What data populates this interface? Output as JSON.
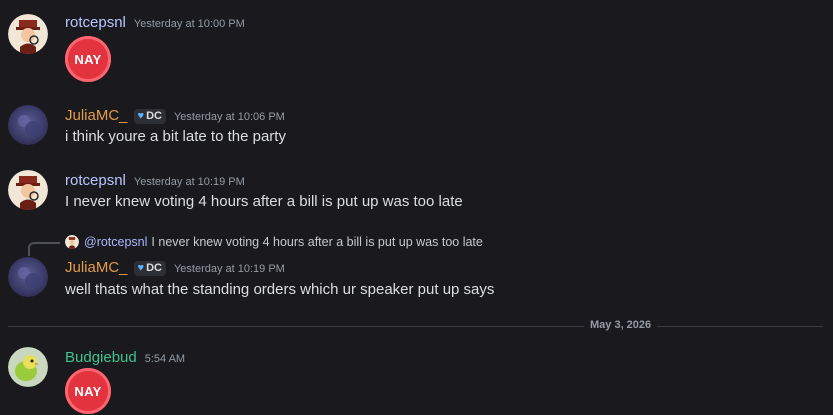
{
  "colors": {
    "background": "#1a1a1e",
    "rotcepsnl": "#b7c7ff",
    "juliamc": "#e59a4b",
    "budgiebud": "#3fc28e",
    "nay_red": "#e2333f"
  },
  "messages": [
    {
      "username": "rotcepsnl",
      "timestamp": "Yesterday at 10:00 PM",
      "emoji_label": "NAY"
    },
    {
      "username": "JuliaMC_",
      "tag": "DC",
      "timestamp": "Yesterday at 10:06 PM",
      "text": "i think youre a bit late to the party"
    },
    {
      "username": "rotcepsnl",
      "timestamp": "Yesterday at 10:19 PM",
      "text": "I never knew voting 4 hours after a bill is put up was too late"
    },
    {
      "reply": {
        "mention": "@rotcepsnl",
        "snippet": "I never knew voting 4 hours after a bill is put up was too late"
      },
      "username": "JuliaMC_",
      "tag": "DC",
      "timestamp": "Yesterday at 10:19 PM",
      "text": "well thats what the standing orders which ur speaker put up says"
    },
    {
      "username": "Budgiebud",
      "timestamp": "5:54 AM",
      "emoji_label": "NAY"
    }
  ],
  "date_divider": "May 3, 2026"
}
